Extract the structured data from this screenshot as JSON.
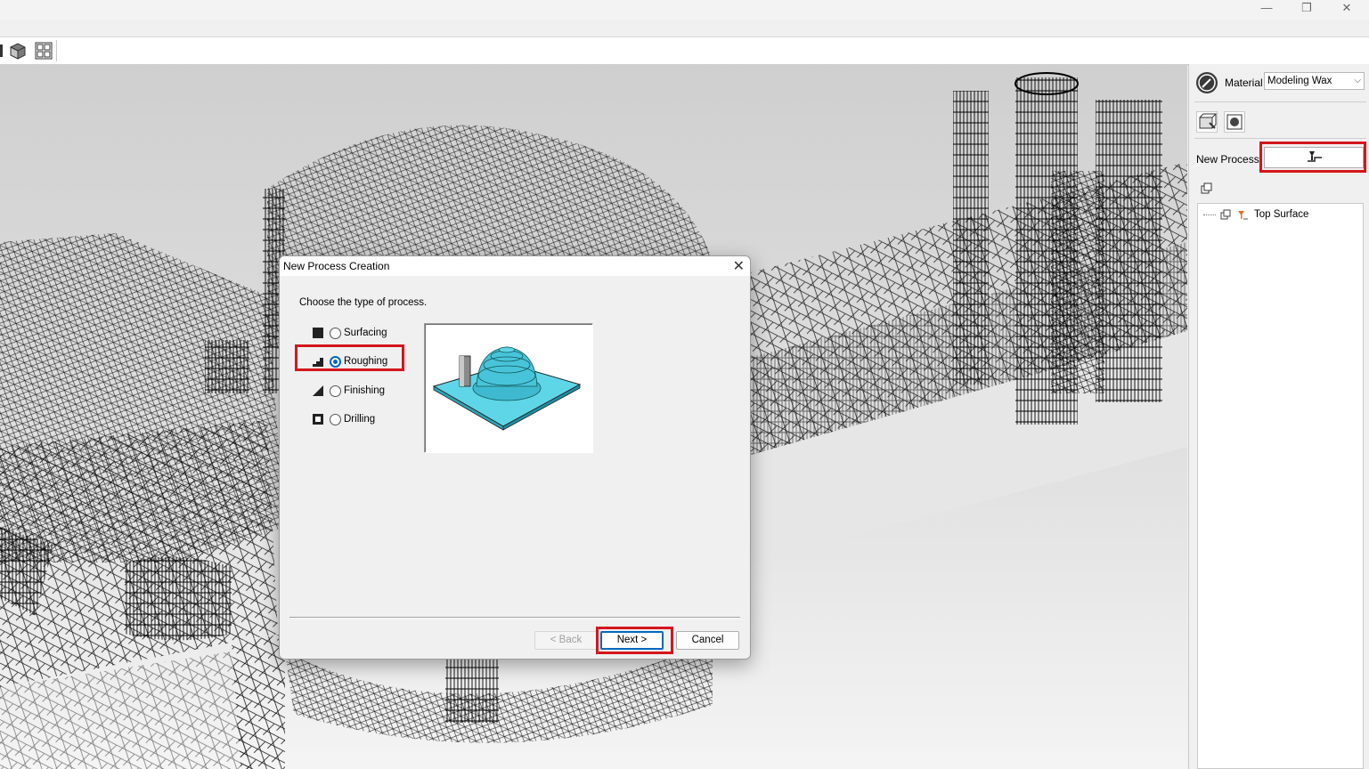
{
  "window": {
    "controls": {
      "minimize": "—",
      "restore": "❐",
      "close": "✕"
    }
  },
  "toolbar": {
    "icons": [
      "solid-view-icon",
      "multi-view-icon"
    ]
  },
  "right_panel": {
    "material_label": "Material",
    "material_value": "Modeling Wax",
    "new_process_label": "New Process",
    "tree": {
      "items": [
        {
          "label": "Top Surface"
        }
      ]
    }
  },
  "dialog": {
    "title": "New Process Creation",
    "prompt": "Choose the type of process.",
    "options": [
      {
        "label": "Surfacing",
        "selected": false
      },
      {
        "label": "Roughing",
        "selected": true
      },
      {
        "label": "Finishing",
        "selected": false
      },
      {
        "label": "Drilling",
        "selected": false
      }
    ],
    "buttons": {
      "back": "< Back",
      "next": "Next >",
      "cancel": "Cancel"
    }
  },
  "colors": {
    "highlight": "#d4161c",
    "accent": "#0067c0",
    "preview_cyan": "#5fd6e8"
  }
}
